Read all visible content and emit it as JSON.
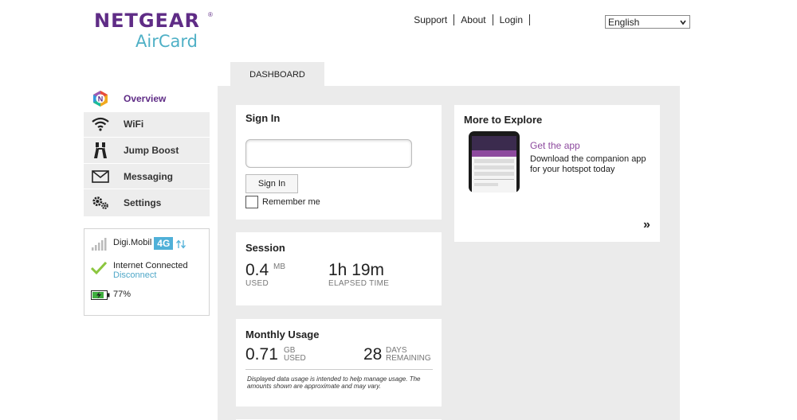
{
  "brand": {
    "name": "NETGEAR",
    "product": "AirCard",
    "color": "#5f2c86",
    "accent": "#4fb0c6"
  },
  "header": {
    "links": [
      "Support",
      "About",
      "Login"
    ],
    "language": "English"
  },
  "tabs": {
    "dashboard": "DASHBOARD"
  },
  "sidebar": {
    "items": [
      {
        "label": "Overview",
        "icon": "netgear-overview-icon"
      },
      {
        "label": "WiFi",
        "icon": "wifi-icon"
      },
      {
        "label": "Jump Boost",
        "icon": "jump-boost-icon"
      },
      {
        "label": "Messaging",
        "icon": "envelope-icon"
      },
      {
        "label": "Settings",
        "icon": "gears-icon"
      }
    ]
  },
  "status": {
    "carrier": "Digi.Mobil",
    "network": "4G",
    "connection": "Internet Connected",
    "disconnect": "Disconnect",
    "battery": "77%"
  },
  "signin": {
    "title": "Sign In",
    "button": "Sign In",
    "remember": "Remember me"
  },
  "session": {
    "title": "Session",
    "used_value": "0.4",
    "used_unit": "MB",
    "used_label": "USED",
    "elapsed_value": "1h 19m",
    "elapsed_label": "ELAPSED TIME"
  },
  "monthly": {
    "title": "Monthly Usage",
    "used_value": "0.71",
    "used_unit": "GB",
    "used_label": "USED",
    "days_value": "28",
    "days_unit": "DAYS",
    "days_label": "REMAINING",
    "disclaimer": "Displayed data usage is intended to help manage usage. The amounts shown are approximate and may vary."
  },
  "explore": {
    "title": "More to Explore",
    "app_link": "Get the app",
    "app_desc": "Download the companion app for your hotspot today",
    "more": "»"
  }
}
